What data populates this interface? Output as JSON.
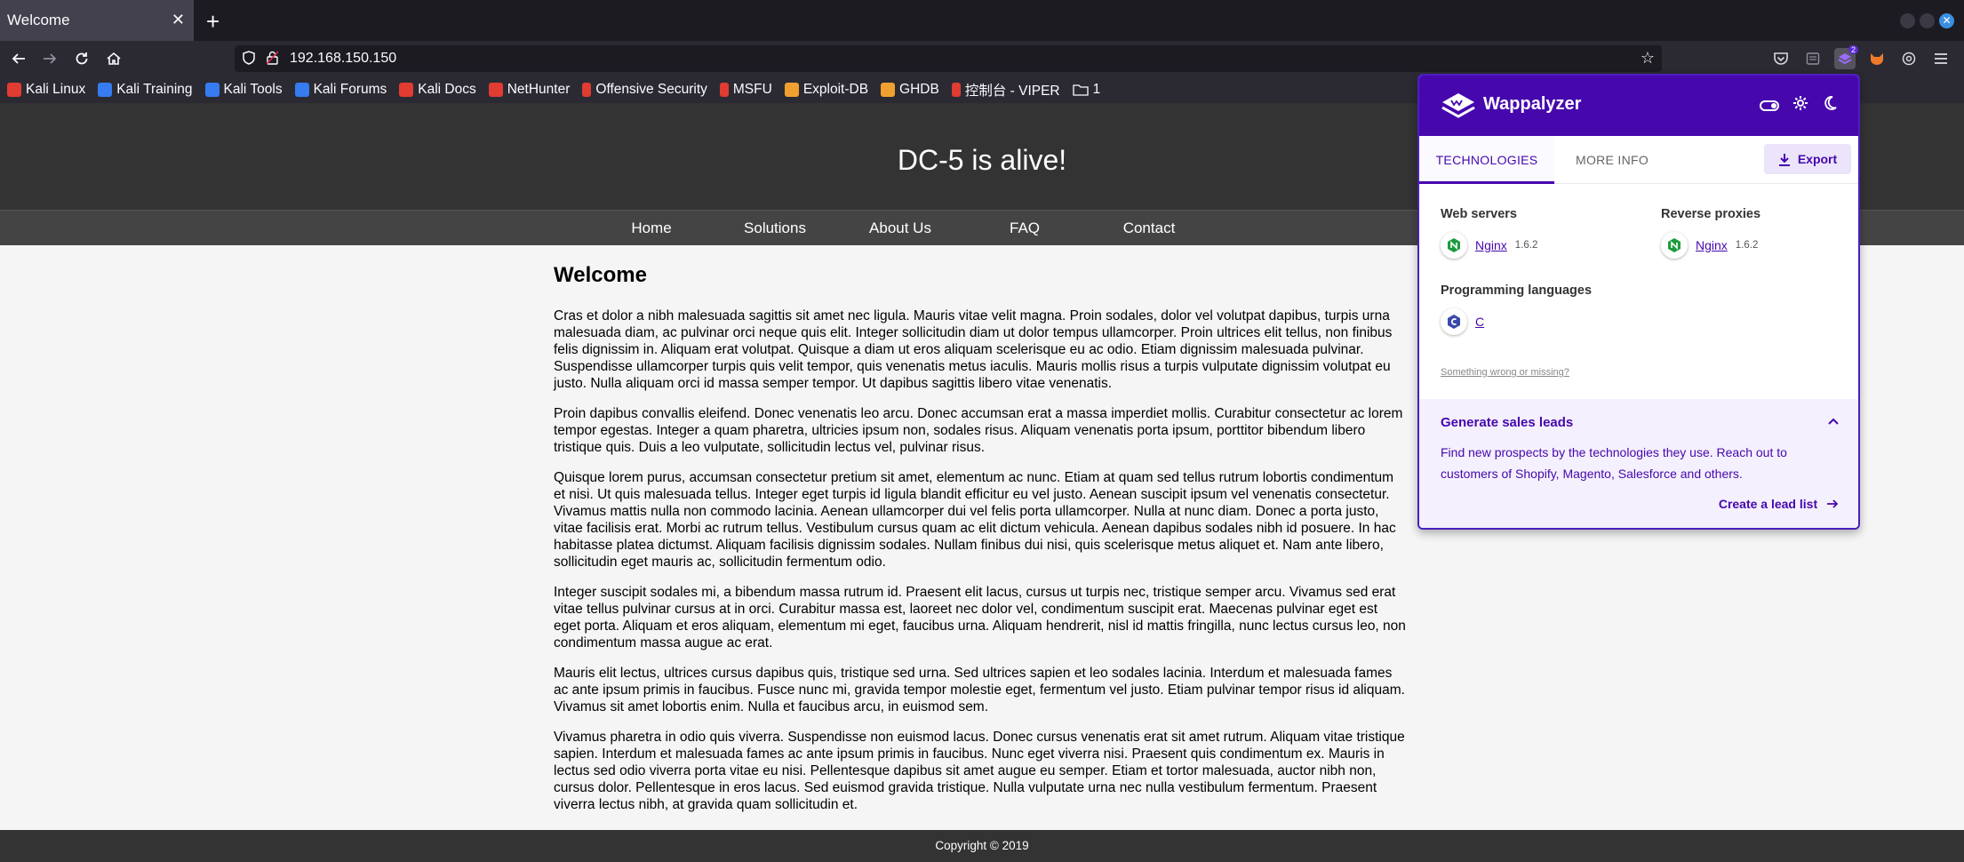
{
  "browser": {
    "tab_title": "Welcome",
    "tab_close": "✕",
    "new_tab": "+",
    "url": "192.168.150.150",
    "extension_badge": "2"
  },
  "bookmarks": [
    {
      "label": "Kali Linux",
      "color": "#e03c31",
      "icon": "kali-dragon-icon"
    },
    {
      "label": "Kali Training",
      "color": "#367bf0",
      "icon": "kali-training-icon"
    },
    {
      "label": "Kali Tools",
      "color": "#367bf0",
      "icon": "kali-tools-icon"
    },
    {
      "label": "Kali Forums",
      "color": "#367bf0",
      "icon": "kali-forums-icon"
    },
    {
      "label": "Kali Docs",
      "color": "#e03c31",
      "icon": "kali-docs-icon"
    },
    {
      "label": "NetHunter",
      "color": "#e03c31",
      "icon": "nethunter-icon"
    },
    {
      "label": "Offensive Security",
      "color": "#e03c31",
      "icon": "offsec-icon"
    },
    {
      "label": "MSFU",
      "color": "#e03c31",
      "icon": "msfu-icon"
    },
    {
      "label": "Exploit-DB",
      "color": "#f0a030",
      "icon": "exploit-db-icon"
    },
    {
      "label": "GHDB",
      "color": "#f0a030",
      "icon": "ghdb-icon"
    },
    {
      "label": "控制台 - VIPER",
      "color": "#e03c31",
      "icon": "viper-icon"
    },
    {
      "label": "1",
      "color": "#cccccc",
      "icon": "folder-icon"
    }
  ],
  "site": {
    "title": "DC-5 is alive!",
    "nav": [
      "Home",
      "Solutions",
      "About Us",
      "FAQ",
      "Contact"
    ],
    "heading": "Welcome",
    "paragraphs": [
      "Cras et dolor a nibh malesuada sagittis sit amet nec ligula. Mauris vitae velit magna. Proin sodales, dolor vel volutpat dapibus, turpis urna malesuada diam, ac pulvinar orci neque quis elit. Integer sollicitudin diam ut dolor tempus ullamcorper. Proin ultrices elit tellus, non finibus felis dignissim in. Aliquam erat volutpat. Quisque a diam ut eros aliquam scelerisque eu ac odio. Etiam dignissim malesuada pulvinar. Suspendisse ullamcorper turpis quis velit tempor, quis venenatis metus iaculis. Mauris mollis risus a turpis vulputate dignissim volutpat eu justo. Nulla aliquam orci id massa semper tempor. Ut dapibus sagittis libero vitae venenatis.",
      "Proin dapibus convallis eleifend. Donec venenatis leo arcu. Donec accumsan erat a massa imperdiet mollis. Curabitur consectetur ac lorem tempor egestas. Integer a quam pharetra, ultricies ipsum non, sodales risus. Aliquam venenatis porta ipsum, porttitor bibendum libero tristique quis. Duis a leo vulputate, sollicitudin lectus vel, pulvinar risus.",
      "Quisque lorem purus, accumsan consectetur pretium sit amet, elementum ac nunc. Etiam at quam sed tellus rutrum lobortis condimentum et nisi. Ut quis malesuada tellus. Integer eget turpis id ligula blandit efficitur eu vel justo. Aenean suscipit ipsum vel venenatis consectetur. Vivamus mattis nulla non commodo lacinia. Aenean ullamcorper dui vel felis porta ullamcorper. Nulla at nunc diam. Donec a porta justo, vitae facilisis erat. Morbi ac rutrum tellus. Vestibulum cursus quam ac elit dictum vehicula. Aenean dapibus sodales nibh id posuere. In hac habitasse platea dictumst. Aliquam facilisis dignissim sodales. Nullam finibus dui nisi, quis scelerisque metus aliquet et. Nam ante libero, sollicitudin eget mauris ac, sollicitudin fermentum odio.",
      "Integer suscipit sodales mi, a bibendum massa rutrum id. Praesent elit lacus, cursus ut turpis nec, tristique semper arcu. Vivamus sed erat vitae tellus pulvinar cursus at in orci. Curabitur massa est, laoreet nec dolor vel, condimentum suscipit erat. Maecenas pulvinar eget est eget porta. Aliquam et eros aliquam, elementum mi eget, faucibus urna. Aliquam hendrerit, nisl id mattis fringilla, nunc lectus cursus leo, non condimentum massa augue ac erat.",
      "Mauris elit lectus, ultrices cursus dapibus quis, tristique sed urna. Sed ultrices sapien et leo sodales lacinia. Interdum et malesuada fames ac ante ipsum primis in faucibus. Fusce nunc mi, gravida tempor molestie eget, fermentum vel justo. Etiam pulvinar tempor risus id aliquam. Vivamus sit amet lobortis enim. Nulla et faucibus arcu, in euismod sem.",
      "Vivamus pharetra in odio quis viverra. Suspendisse non euismod lacus. Donec cursus venenatis erat sit amet rutrum. Aliquam vitae tristique sapien. Interdum et malesuada fames ac ante ipsum primis in faucibus. Nunc eget viverra nisi. Praesent quis condimentum ex. Mauris in lectus sed odio viverra porta vitae eu nisi. Pellentesque dapibus sit amet augue eu semper. Etiam et tortor malesuada, auctor nibh non, cursus dolor. Pellentesque in eros lacus. Sed euismod gravida tristique. Nulla vulputate urna nec nulla vestibulum fermentum. Praesent viverra lectus nibh, at gravida quam sollicitudin et."
    ],
    "footer": "Copyright © 2019"
  },
  "wappalyzer": {
    "name": "Wappalyzer",
    "accent": "#4608ad",
    "tabs": {
      "technologies": "TECHNOLOGIES",
      "more_info": "MORE INFO"
    },
    "export_label": "Export",
    "categories": [
      {
        "name": "Web servers",
        "tech": "Nginx",
        "version": "1.6.2",
        "icon": "nginx-icon"
      },
      {
        "name": "Reverse proxies",
        "tech": "Nginx",
        "version": "1.6.2",
        "icon": "nginx-icon"
      },
      {
        "name": "Programming languages",
        "tech": "C",
        "version": "",
        "icon": "c-language-icon"
      }
    ],
    "wrong_link": "Something wrong or missing?",
    "leads": {
      "title": "Generate sales leads",
      "text": "Find new prospects by the technologies they use. Reach out to customers of Shopify, Magento, Salesforce and others.",
      "cta": "Create a lead list"
    }
  }
}
